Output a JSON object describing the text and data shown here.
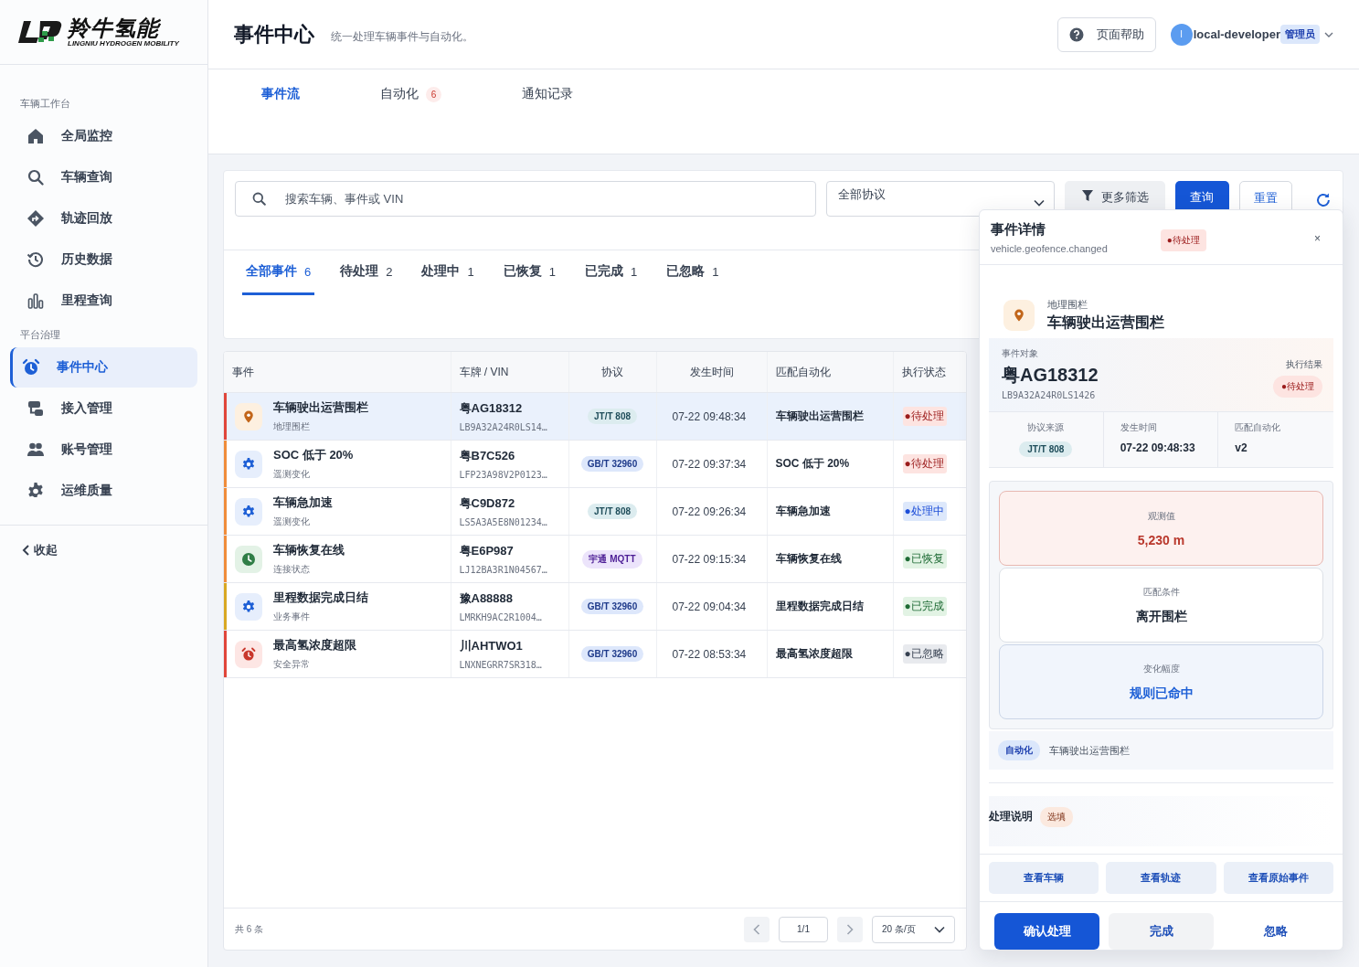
{
  "brand": {
    "name": "羚牛氢能",
    "tagline": "LINGNIU HYDROGEN MOBILITY"
  },
  "sidebar": {
    "groups": [
      {
        "title": "车辆工作台",
        "items": [
          {
            "label": "全局监控",
            "selected": false
          },
          {
            "label": "车辆查询",
            "selected": false
          },
          {
            "label": "轨迹回放",
            "selected": false
          },
          {
            "label": "历史数据",
            "selected": false
          },
          {
            "label": "里程查询",
            "selected": false
          }
        ]
      },
      {
        "title": "平台治理",
        "items": [
          {
            "label": "事件中心",
            "selected": true
          },
          {
            "label": "接入管理",
            "selected": false
          },
          {
            "label": "账号管理",
            "selected": false
          },
          {
            "label": "运维质量",
            "selected": false
          }
        ]
      }
    ],
    "collapse": "收起"
  },
  "header": {
    "title": "事件中心",
    "subtitle": "统一处理车辆事件与自动化。",
    "help": "页面帮助",
    "user": {
      "initial": "l",
      "name": "local-developer",
      "role": "管理员"
    }
  },
  "tabs": [
    {
      "label": "事件流",
      "selected": true
    },
    {
      "label": "自动化",
      "count": "6",
      "selected": false
    },
    {
      "label": "通知记录",
      "selected": false
    }
  ],
  "filters": {
    "search": {
      "placeholder": "搜索车辆、事件或 VIN"
    },
    "protocol": "全部协议",
    "buttons": [
      {
        "label": "更多筛选",
        "kind": "secondary"
      },
      {
        "label": "查询",
        "kind": "primary"
      },
      {
        "label": "重置",
        "kind": "outline"
      }
    ]
  },
  "status_tabs": [
    {
      "label": "全部事件",
      "count": "6",
      "selected": true
    },
    {
      "label": "待处理",
      "count": "2",
      "selected": false
    },
    {
      "label": "处理中",
      "count": "1",
      "selected": false
    },
    {
      "label": "已恢复",
      "count": "1",
      "selected": false
    },
    {
      "label": "已完成",
      "count": "1",
      "selected": false
    },
    {
      "label": "已忽略",
      "count": "1",
      "selected": false
    }
  ],
  "table": {
    "columns": [
      "事件",
      "车牌 / VIN",
      "协议",
      "发生时间",
      "匹配自动化",
      "执行状态"
    ],
    "rows": [
      {
        "title": "车辆驶出运营围栏",
        "category": "地理围栏",
        "kind": "geofence",
        "color": "#e0453a",
        "plate": "粤AG18312",
        "vin": "LB9A32A24R0LS14…",
        "protocol": {
          "label": "JT/T 808",
          "kind": "jtt"
        },
        "time": "07-22 09:48:34",
        "automation": "车辆驶出运营围栏",
        "status": {
          "label": "●待处理",
          "kind": "pending"
        },
        "selected": true
      },
      {
        "title": "SOC 低于 20%",
        "category": "遥测变化",
        "kind": "telemetry",
        "color": "#f08c3a",
        "plate": "粤B7C526",
        "vin": "LFP23A98V2P0123…",
        "protocol": {
          "label": "GB/T 32960",
          "kind": "gbt"
        },
        "time": "07-22 09:37:34",
        "automation": "SOC 低于 20%",
        "status": {
          "label": "●待处理",
          "kind": "pending"
        },
        "selected": false
      },
      {
        "title": "车辆急加速",
        "category": "遥测变化",
        "kind": "telemetry",
        "color": "#f08c3a",
        "plate": "粤C9D872",
        "vin": "LS5A3A5E8N01234…",
        "protocol": {
          "label": "JT/T 808",
          "kind": "jtt"
        },
        "time": "07-22 09:26:34",
        "automation": "车辆急加速",
        "status": {
          "label": "●处理中",
          "kind": "processing"
        },
        "selected": false
      },
      {
        "title": "车辆恢复在线",
        "category": "连接状态",
        "kind": "connection",
        "color": "#f08c3a",
        "plate": "粤E6P987",
        "vin": "LJ12BA3R1N04567…",
        "protocol": {
          "label": "宇通 MQTT",
          "kind": "mqtt"
        },
        "time": "07-22 09:15:34",
        "automation": "车辆恢复在线",
        "status": {
          "label": "●已恢复",
          "kind": "recovered"
        },
        "selected": false
      },
      {
        "title": "里程数据完成日结",
        "category": "业务事件",
        "kind": "business",
        "color": "#d9a822",
        "plate": "豫A88888",
        "vin": "LMRKH9AC2R1004…",
        "protocol": {
          "label": "GB/T 32960",
          "kind": "gbt"
        },
        "time": "07-22 09:04:34",
        "automation": "里程数据完成日结",
        "status": {
          "label": "●已完成",
          "kind": "completed"
        },
        "selected": false
      },
      {
        "title": "最高氢浓度超限",
        "category": "安全异常",
        "kind": "safety",
        "color": "#e0453a",
        "plate": "川AHTWO1",
        "vin": "LNXNEGRR7SR318…",
        "protocol": {
          "label": "GB/T 32960",
          "kind": "gbt"
        },
        "time": "07-22 08:53:34",
        "automation": "最高氢浓度超限",
        "status": {
          "label": "●已忽略",
          "kind": "ignored"
        },
        "selected": false
      }
    ]
  },
  "footer": {
    "total": "共 6 条",
    "page": "1/1",
    "page_size": "20 条/页"
  },
  "detail": {
    "title": "事件详情",
    "event_type": "vehicle.geofence.changed",
    "status": {
      "label": "●待处理",
      "kind": "pending"
    },
    "close": "×",
    "category": "地理围栏",
    "name": "车辆驶出运营围栏",
    "kind": "geofence",
    "object_label": "事件对象",
    "plate": "粤AG18312",
    "vin": "LB9A32A24R0LS1426",
    "result_label": "执行结果",
    "result": {
      "label": "●待处理",
      "kind": "pending"
    },
    "facts": [
      {
        "label": "协议来源",
        "value": "JT/T 808",
        "kind": "protocol"
      },
      {
        "label": "发生时间",
        "value": "07-22 09:48:33",
        "kind": "text"
      },
      {
        "label": "匹配自动化",
        "value": "v2",
        "kind": "text"
      }
    ],
    "metrics": [
      {
        "label": "观测值",
        "value": "5,230 m",
        "kind": "alert"
      },
      {
        "label": "匹配条件",
        "value": "离开围栏",
        "kind": "plain"
      },
      {
        "label": "变化幅度",
        "value": "规则已命中",
        "kind": "info"
      }
    ],
    "automation": {
      "tag": "自动化",
      "name": "车辆驶出运营围栏"
    },
    "note": {
      "label": "处理说明",
      "tag": "选填"
    },
    "links": [
      "查看车辆",
      "查看轨迹",
      "查看原始事件"
    ],
    "actions": [
      {
        "label": "确认处理",
        "kind": "primary"
      },
      {
        "label": "完成",
        "kind": "secondary"
      },
      {
        "label": "忽略",
        "kind": "text"
      }
    ]
  }
}
